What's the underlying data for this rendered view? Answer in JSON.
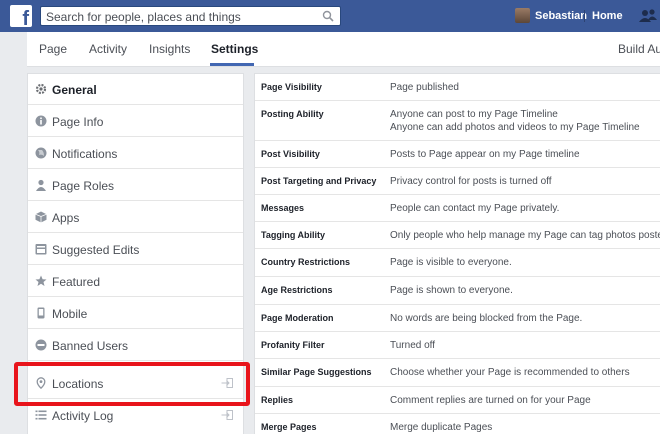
{
  "topbar": {
    "logo": "f",
    "search_placeholder": "Search for people, places and things",
    "user_name": "Sebastian",
    "home_label": "Home"
  },
  "tabs": [
    {
      "label": "Page"
    },
    {
      "label": "Activity"
    },
    {
      "label": "Insights"
    },
    {
      "label": "Settings"
    }
  ],
  "build_audience": "Build Aud",
  "menu": [
    {
      "label": "General",
      "icon": "gear-icon"
    },
    {
      "label": "Page Info",
      "icon": "info-icon"
    },
    {
      "label": "Notifications",
      "icon": "globe-icon"
    },
    {
      "label": "Page Roles",
      "icon": "person-icon"
    },
    {
      "label": "Apps",
      "icon": "cube-icon"
    },
    {
      "label": "Suggested Edits",
      "icon": "suggested-edits-icon"
    },
    {
      "label": "Featured",
      "icon": "star-icon"
    },
    {
      "label": "Mobile",
      "icon": "mobile-icon"
    },
    {
      "label": "Banned Users",
      "icon": "banned-icon"
    },
    {
      "label": "Locations",
      "icon": "location-pin-icon"
    },
    {
      "label": "Activity Log",
      "icon": "list-icon"
    }
  ],
  "settings": [
    {
      "label": "Page Visibility",
      "value": "Page published"
    },
    {
      "label": "Posting Ability",
      "value": "Anyone can post to my Page Timeline",
      "value2": "Anyone can add photos and videos to my Page Timeline"
    },
    {
      "label": "Post Visibility",
      "value": "Posts to Page appear on my Page timeline"
    },
    {
      "label": "Post Targeting and Privacy",
      "value": "Privacy control for posts is turned off"
    },
    {
      "label": "Messages",
      "value": "People can contact my Page privately."
    },
    {
      "label": "Tagging Ability",
      "value": "Only people who help manage my Page can tag photos posted on it"
    },
    {
      "label": "Country Restrictions",
      "value": "Page is visible to everyone."
    },
    {
      "label": "Age Restrictions",
      "value": "Page is shown to everyone."
    },
    {
      "label": "Page Moderation",
      "value": "No words are being blocked from the Page."
    },
    {
      "label": "Profanity Filter",
      "value": "Turned off"
    },
    {
      "label": "Similar Page Suggestions",
      "value": "Choose whether your Page is recommended to others"
    },
    {
      "label": "Replies",
      "value": "Comment replies are turned on for your Page"
    },
    {
      "label": "Merge Pages",
      "value": "Merge duplicate Pages"
    }
  ],
  "colors": {
    "brand": "#3b5998",
    "highlight": "#e8141b"
  }
}
